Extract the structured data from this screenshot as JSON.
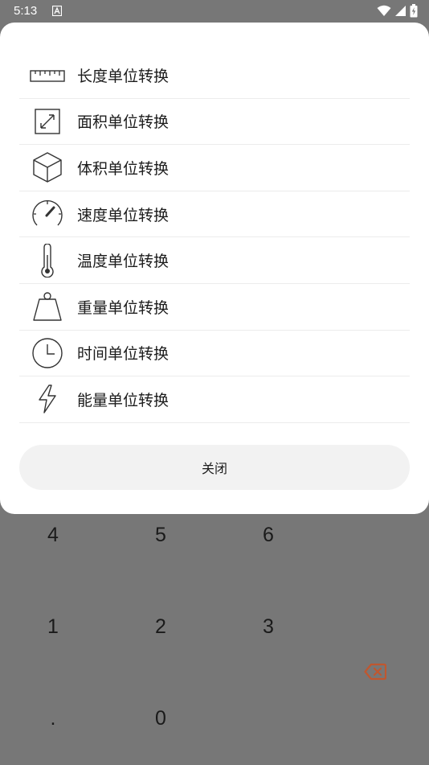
{
  "status_bar": {
    "time": "5:13",
    "icons": [
      "a-notification-icon",
      "wifi-icon",
      "signal-icon",
      "battery-charging-icon"
    ]
  },
  "dialog": {
    "items": [
      {
        "label": "长度单位转换",
        "icon": "ruler-icon"
      },
      {
        "label": "面积单位转换",
        "icon": "area-expand-icon"
      },
      {
        "label": "体积单位转换",
        "icon": "cube-icon"
      },
      {
        "label": "速度单位转换",
        "icon": "speedometer-icon"
      },
      {
        "label": "温度单位转换",
        "icon": "thermometer-icon"
      },
      {
        "label": "重量单位转换",
        "icon": "weight-icon"
      },
      {
        "label": "时间单位转换",
        "icon": "clock-icon"
      },
      {
        "label": "能量单位转换",
        "icon": "lightning-icon"
      }
    ],
    "close_label": "关闭"
  },
  "keypad": {
    "keys": [
      "4",
      "5",
      "6",
      "1",
      "2",
      "3",
      ".",
      "0"
    ],
    "backspace_icon": "backspace-icon",
    "accent_color": "#c0572f"
  },
  "colors": {
    "scrim": "#777777",
    "sheet": "#ffffff",
    "button_bg": "#f2f2f2"
  }
}
